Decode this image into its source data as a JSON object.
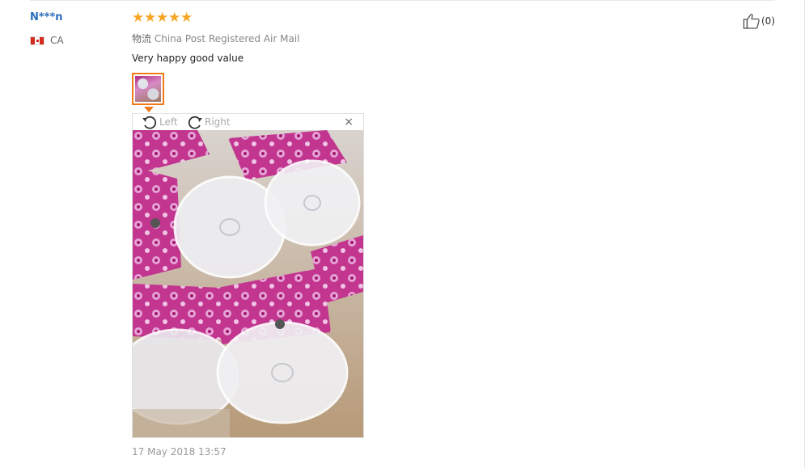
{
  "review": {
    "user_name": "N***n",
    "country_code": "CA",
    "rating": 5,
    "stars": [
      "★",
      "★",
      "★",
      "★",
      "★"
    ],
    "logistics_label": "物流",
    "logistics_value": "China Post Registered Air Mail",
    "text": "Very happy good value",
    "like_count": "(0)",
    "date": "17 May 2018 13:57"
  },
  "viewer": {
    "rotate_left_label": "Left",
    "rotate_right_label": "Right",
    "close_glyph": "×"
  },
  "icons": {
    "flag": "canada-flag-icon",
    "like": "thumbs-up-icon",
    "rotate_left": "rotate-left-icon",
    "rotate_right": "rotate-right-icon"
  },
  "colors": {
    "username": "#2a6ebb",
    "star": "#f5a623",
    "thumb_border": "#f07a1a"
  }
}
